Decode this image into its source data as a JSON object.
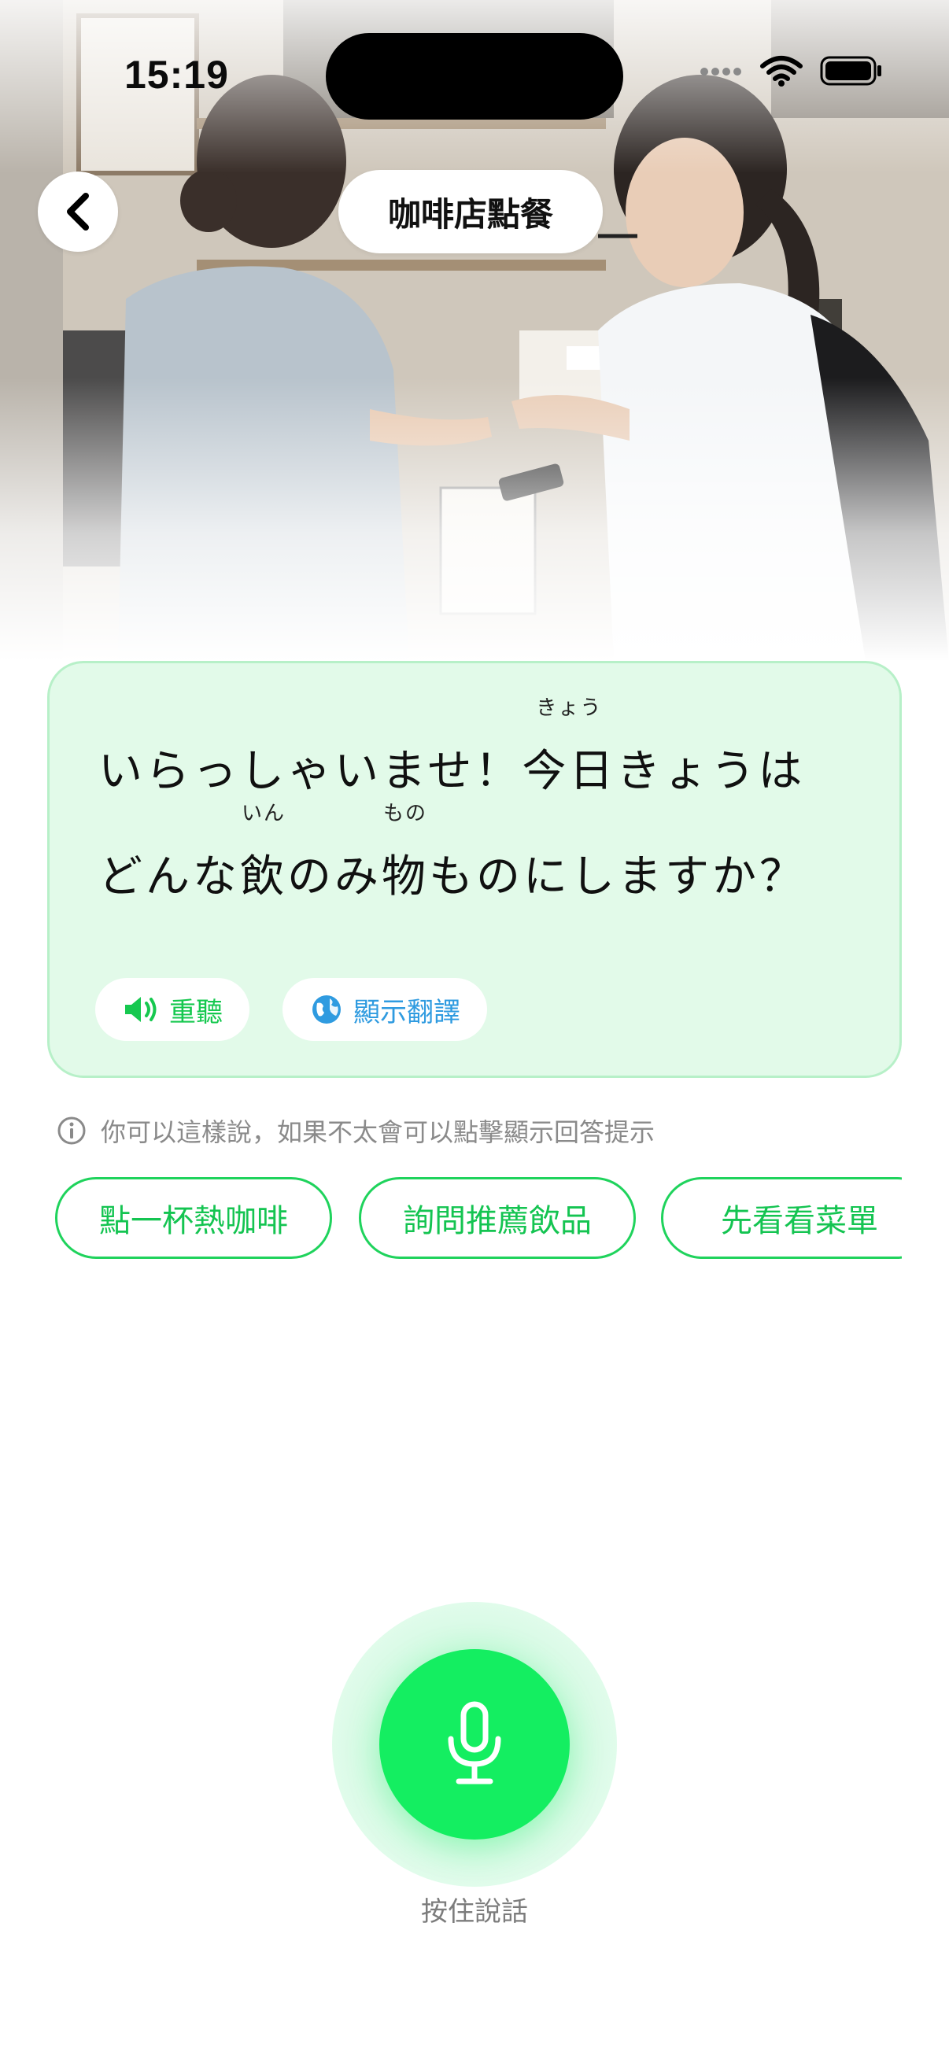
{
  "status_bar": {
    "time": "15:19"
  },
  "header": {
    "title": "咖啡店點餐"
  },
  "dialogue": {
    "line1": [
      {
        "text": "いらっしゃいませ！"
      },
      {
        "text": "今日",
        "ruby": "きょう"
      },
      {
        "text": "きょうは"
      }
    ],
    "line2": [
      {
        "text": "どんな"
      },
      {
        "text": "飲",
        "ruby": "いん"
      },
      {
        "text": "のみ"
      },
      {
        "text": "物",
        "ruby": "もの"
      },
      {
        "text": "ものにしますか？"
      }
    ],
    "replay_label": "重聽",
    "translate_label": "顯示翻譯"
  },
  "hint": {
    "text": "你可以這樣說，如果不太會可以點擊顯示回答提示"
  },
  "suggestions": [
    "點一杯熱咖啡",
    "詢問推薦飲品",
    "先看看菜單"
  ],
  "mic": {
    "label": "按住說話"
  },
  "colors": {
    "accent_green": "#14ee61",
    "chip_green": "#1fd35c",
    "card_bg": "#e2fae9",
    "translate_blue": "#2f9be0"
  },
  "icons": [
    "back-chevron-icon",
    "speaker-icon",
    "globe-icon",
    "info-icon",
    "microphone-icon",
    "wifi-icon",
    "battery-icon"
  ]
}
